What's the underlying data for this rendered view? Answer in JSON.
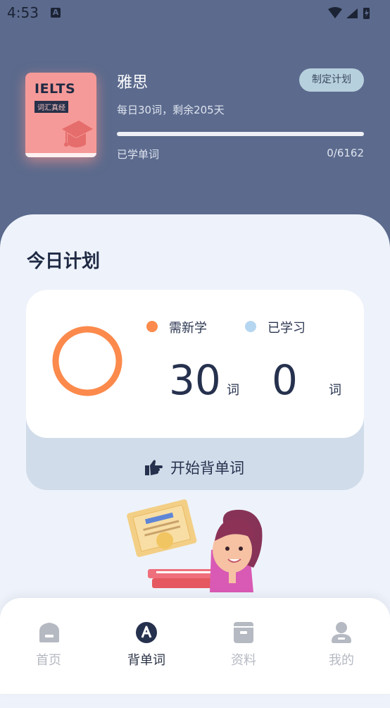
{
  "status_bar": {
    "time": "4:53"
  },
  "book": {
    "cover_title": "IELTS",
    "cover_subtitle": "词汇真经",
    "name": "雅思",
    "plan_info": "每日30词，剩余205天",
    "plan_button": "制定计划",
    "learned_label": "已学单词",
    "learned_count": "0/6162",
    "progress_fraction": 0
  },
  "today": {
    "heading": "今日计划",
    "new_label": "需新学",
    "learned_label": "已学习",
    "new_count": "30",
    "learned_count": "0",
    "unit": "词",
    "start_button": "开始背单词",
    "colors": {
      "new": "#fb8a4c",
      "learned": "#b5d6f1"
    }
  },
  "nav": {
    "items": [
      {
        "label": "首页",
        "icon": "home-icon",
        "active": false
      },
      {
        "label": "背单词",
        "icon": "words-icon",
        "active": true
      },
      {
        "label": "资料",
        "icon": "materials-icon",
        "active": false
      },
      {
        "label": "我的",
        "icon": "profile-icon",
        "active": false
      }
    ]
  }
}
